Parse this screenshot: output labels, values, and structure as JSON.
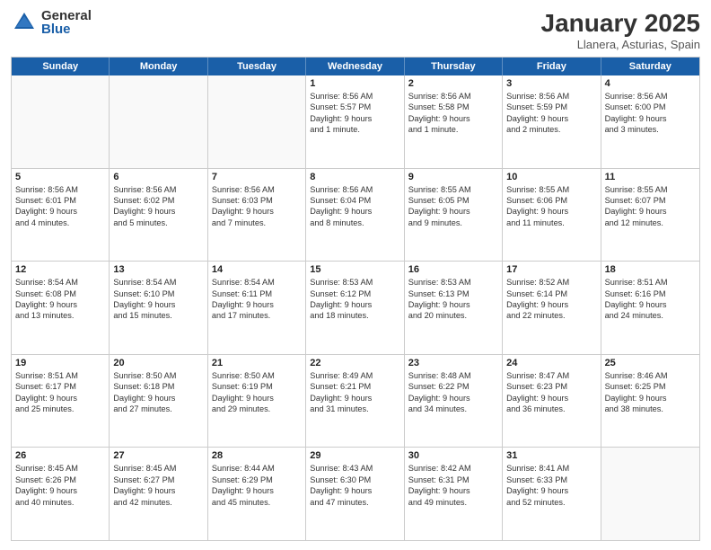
{
  "logo": {
    "general": "General",
    "blue": "Blue"
  },
  "header": {
    "month": "January 2025",
    "location": "Llanera, Asturias, Spain"
  },
  "days": [
    "Sunday",
    "Monday",
    "Tuesday",
    "Wednesday",
    "Thursday",
    "Friday",
    "Saturday"
  ],
  "rows": [
    [
      {
        "day": "",
        "lines": []
      },
      {
        "day": "",
        "lines": []
      },
      {
        "day": "",
        "lines": []
      },
      {
        "day": "1",
        "lines": [
          "Sunrise: 8:56 AM",
          "Sunset: 5:57 PM",
          "Daylight: 9 hours",
          "and 1 minute."
        ]
      },
      {
        "day": "2",
        "lines": [
          "Sunrise: 8:56 AM",
          "Sunset: 5:58 PM",
          "Daylight: 9 hours",
          "and 1 minute."
        ]
      },
      {
        "day": "3",
        "lines": [
          "Sunrise: 8:56 AM",
          "Sunset: 5:59 PM",
          "Daylight: 9 hours",
          "and 2 minutes."
        ]
      },
      {
        "day": "4",
        "lines": [
          "Sunrise: 8:56 AM",
          "Sunset: 6:00 PM",
          "Daylight: 9 hours",
          "and 3 minutes."
        ]
      }
    ],
    [
      {
        "day": "5",
        "lines": [
          "Sunrise: 8:56 AM",
          "Sunset: 6:01 PM",
          "Daylight: 9 hours",
          "and 4 minutes."
        ]
      },
      {
        "day": "6",
        "lines": [
          "Sunrise: 8:56 AM",
          "Sunset: 6:02 PM",
          "Daylight: 9 hours",
          "and 5 minutes."
        ]
      },
      {
        "day": "7",
        "lines": [
          "Sunrise: 8:56 AM",
          "Sunset: 6:03 PM",
          "Daylight: 9 hours",
          "and 7 minutes."
        ]
      },
      {
        "day": "8",
        "lines": [
          "Sunrise: 8:56 AM",
          "Sunset: 6:04 PM",
          "Daylight: 9 hours",
          "and 8 minutes."
        ]
      },
      {
        "day": "9",
        "lines": [
          "Sunrise: 8:55 AM",
          "Sunset: 6:05 PM",
          "Daylight: 9 hours",
          "and 9 minutes."
        ]
      },
      {
        "day": "10",
        "lines": [
          "Sunrise: 8:55 AM",
          "Sunset: 6:06 PM",
          "Daylight: 9 hours",
          "and 11 minutes."
        ]
      },
      {
        "day": "11",
        "lines": [
          "Sunrise: 8:55 AM",
          "Sunset: 6:07 PM",
          "Daylight: 9 hours",
          "and 12 minutes."
        ]
      }
    ],
    [
      {
        "day": "12",
        "lines": [
          "Sunrise: 8:54 AM",
          "Sunset: 6:08 PM",
          "Daylight: 9 hours",
          "and 13 minutes."
        ]
      },
      {
        "day": "13",
        "lines": [
          "Sunrise: 8:54 AM",
          "Sunset: 6:10 PM",
          "Daylight: 9 hours",
          "and 15 minutes."
        ]
      },
      {
        "day": "14",
        "lines": [
          "Sunrise: 8:54 AM",
          "Sunset: 6:11 PM",
          "Daylight: 9 hours",
          "and 17 minutes."
        ]
      },
      {
        "day": "15",
        "lines": [
          "Sunrise: 8:53 AM",
          "Sunset: 6:12 PM",
          "Daylight: 9 hours",
          "and 18 minutes."
        ]
      },
      {
        "day": "16",
        "lines": [
          "Sunrise: 8:53 AM",
          "Sunset: 6:13 PM",
          "Daylight: 9 hours",
          "and 20 minutes."
        ]
      },
      {
        "day": "17",
        "lines": [
          "Sunrise: 8:52 AM",
          "Sunset: 6:14 PM",
          "Daylight: 9 hours",
          "and 22 minutes."
        ]
      },
      {
        "day": "18",
        "lines": [
          "Sunrise: 8:51 AM",
          "Sunset: 6:16 PM",
          "Daylight: 9 hours",
          "and 24 minutes."
        ]
      }
    ],
    [
      {
        "day": "19",
        "lines": [
          "Sunrise: 8:51 AM",
          "Sunset: 6:17 PM",
          "Daylight: 9 hours",
          "and 25 minutes."
        ]
      },
      {
        "day": "20",
        "lines": [
          "Sunrise: 8:50 AM",
          "Sunset: 6:18 PM",
          "Daylight: 9 hours",
          "and 27 minutes."
        ]
      },
      {
        "day": "21",
        "lines": [
          "Sunrise: 8:50 AM",
          "Sunset: 6:19 PM",
          "Daylight: 9 hours",
          "and 29 minutes."
        ]
      },
      {
        "day": "22",
        "lines": [
          "Sunrise: 8:49 AM",
          "Sunset: 6:21 PM",
          "Daylight: 9 hours",
          "and 31 minutes."
        ]
      },
      {
        "day": "23",
        "lines": [
          "Sunrise: 8:48 AM",
          "Sunset: 6:22 PM",
          "Daylight: 9 hours",
          "and 34 minutes."
        ]
      },
      {
        "day": "24",
        "lines": [
          "Sunrise: 8:47 AM",
          "Sunset: 6:23 PM",
          "Daylight: 9 hours",
          "and 36 minutes."
        ]
      },
      {
        "day": "25",
        "lines": [
          "Sunrise: 8:46 AM",
          "Sunset: 6:25 PM",
          "Daylight: 9 hours",
          "and 38 minutes."
        ]
      }
    ],
    [
      {
        "day": "26",
        "lines": [
          "Sunrise: 8:45 AM",
          "Sunset: 6:26 PM",
          "Daylight: 9 hours",
          "and 40 minutes."
        ]
      },
      {
        "day": "27",
        "lines": [
          "Sunrise: 8:45 AM",
          "Sunset: 6:27 PM",
          "Daylight: 9 hours",
          "and 42 minutes."
        ]
      },
      {
        "day": "28",
        "lines": [
          "Sunrise: 8:44 AM",
          "Sunset: 6:29 PM",
          "Daylight: 9 hours",
          "and 45 minutes."
        ]
      },
      {
        "day": "29",
        "lines": [
          "Sunrise: 8:43 AM",
          "Sunset: 6:30 PM",
          "Daylight: 9 hours",
          "and 47 minutes."
        ]
      },
      {
        "day": "30",
        "lines": [
          "Sunrise: 8:42 AM",
          "Sunset: 6:31 PM",
          "Daylight: 9 hours",
          "and 49 minutes."
        ]
      },
      {
        "day": "31",
        "lines": [
          "Sunrise: 8:41 AM",
          "Sunset: 6:33 PM",
          "Daylight: 9 hours",
          "and 52 minutes."
        ]
      },
      {
        "day": "",
        "lines": []
      }
    ]
  ]
}
